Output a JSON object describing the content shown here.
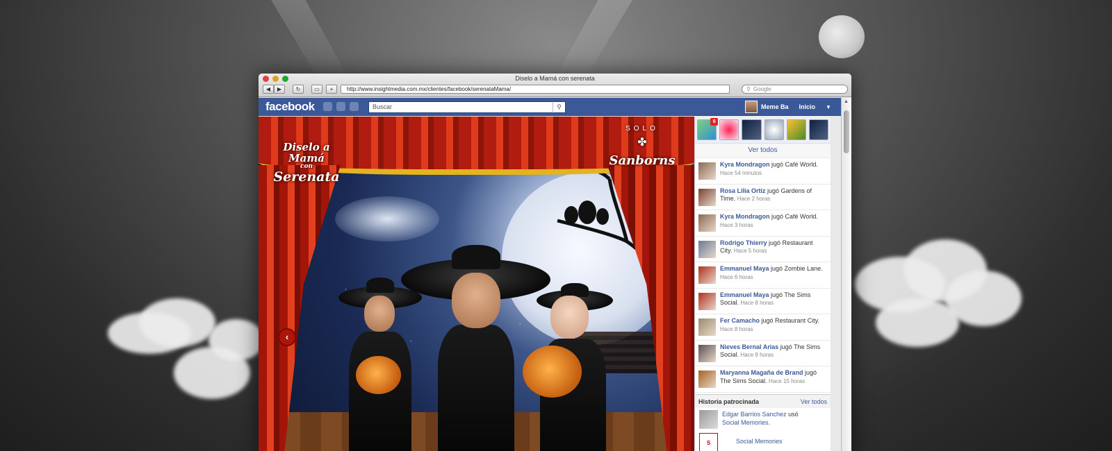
{
  "window": {
    "title": "Diselo a Mamá con serenata",
    "url": "http://www.insightmedia.com.mx/clientes/facebook/serenataMama/",
    "search_placeholder": "Google"
  },
  "facebook": {
    "logo": "facebook",
    "search_placeholder": "Buscar",
    "user_name": "Meme Ba",
    "home_label": "Inicio"
  },
  "app": {
    "logo_line1": "Diselo a Mamá",
    "logo_line2": "con",
    "logo_line3": "Serenata",
    "sponsor_top": "SOLO",
    "sponsor_brand": "Sanborns"
  },
  "sidebar": {
    "games_badge": "6",
    "see_all": "Ver todos",
    "feed": [
      {
        "name": "Kyra Mondragon",
        "action": " jugó Café World.",
        "time": "Hace 54 minutos",
        "color": "#8a6a55"
      },
      {
        "name": "Rosa Lilia Ortiz",
        "action": " jugó Gardens of Time.",
        "time": "Hace 2 horas",
        "color": "#7b4030"
      },
      {
        "name": "Kyra Mondragon",
        "action": " jugó Café World.",
        "time": "Hace 3 horas",
        "color": "#8a6a55"
      },
      {
        "name": "Rodrigo Thierry",
        "action": " jugó Restaurant City.",
        "time": "Hace 5 horas",
        "color": "#6a7a9a"
      },
      {
        "name": "Emmanuel Maya",
        "action": " jugó Zombie Lane.",
        "time": "Hace 6 horas",
        "color": "#b03020"
      },
      {
        "name": "Emmanuel Maya",
        "action": " jugó The Sims Social.",
        "time": "Hace 8 horas",
        "color": "#b03020"
      },
      {
        "name": "Fer Camacho",
        "action": " jugó Restaurant City.",
        "time": "Hace 8 horas",
        "color": "#9a8a70"
      },
      {
        "name": "Nieves Bernal Arias",
        "action": " jugó The Sims Social.",
        "time": "Hace 9 horas",
        "color": "#5a5050"
      },
      {
        "name": "Maryanna Magaña de Brand",
        "action": " jugó The Sims Social.",
        "time": "Hace 15 horas",
        "color": "#a86020"
      }
    ],
    "sponsored_label": "Historia patrocinada",
    "sponsored_link": "Ver todos",
    "sponsored_story_name": "Edgar Barrios Sanchez",
    "sponsored_story_verb": " usó",
    "sponsored_story_app": "Social Memories.",
    "sponsored_app_title": "Social Memories"
  }
}
